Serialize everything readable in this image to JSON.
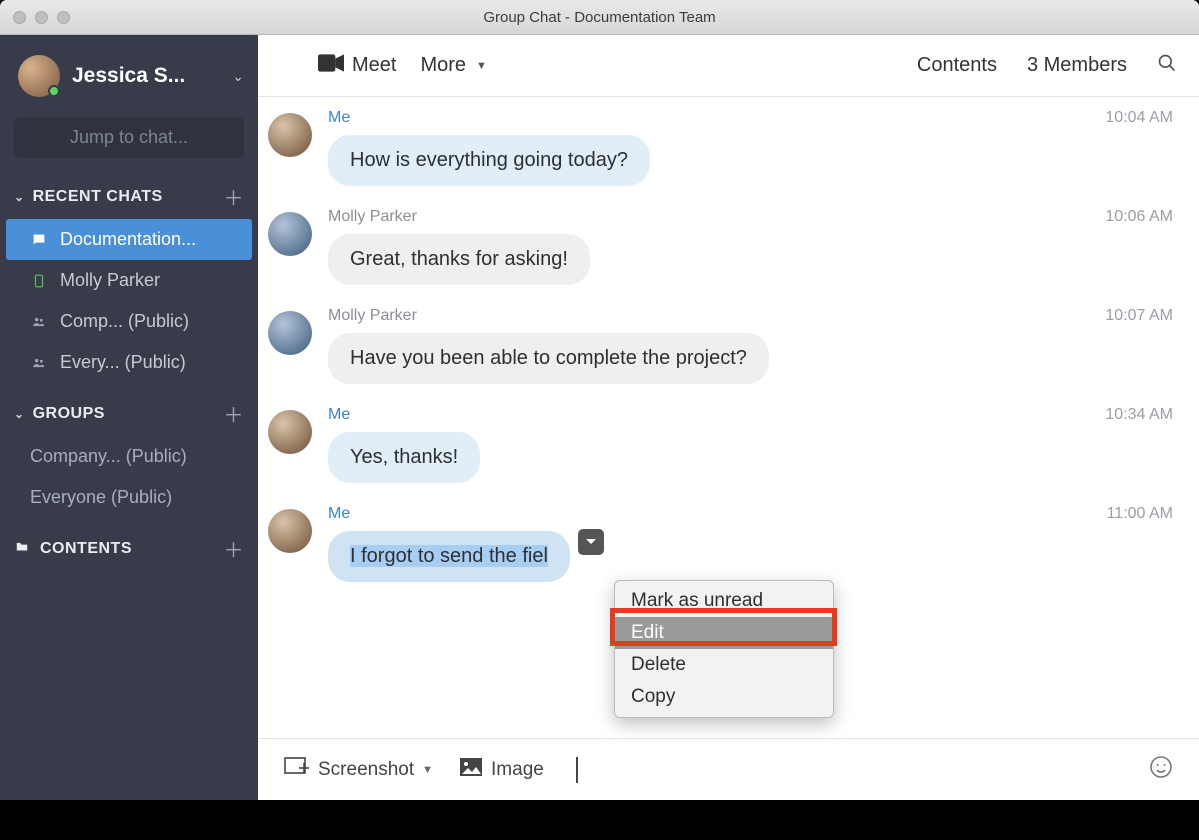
{
  "window": {
    "title": "Group Chat - Documentation Team"
  },
  "sidebar": {
    "profile_name": "Jessica S...",
    "jump_placeholder": "Jump to chat...",
    "sections": {
      "recent": {
        "label": "RECENT CHATS"
      },
      "groups": {
        "label": "GROUPS"
      },
      "contents": {
        "label": "CONTENTS"
      }
    },
    "recent_items": [
      {
        "label": "Documentation..."
      },
      {
        "label": "Molly Parker"
      },
      {
        "label": "Comp... (Public)"
      },
      {
        "label": "Every... (Public)"
      }
    ],
    "group_items": [
      {
        "label": "Company... (Public)"
      },
      {
        "label": "Everyone (Public)"
      }
    ]
  },
  "topbar": {
    "meet": "Meet",
    "more": "More",
    "contents": "Contents",
    "members": "3 Members"
  },
  "messages": [
    {
      "sender": "Me",
      "me": true,
      "time": "10:04 AM",
      "text": "How is everything going today?"
    },
    {
      "sender": "Molly Parker",
      "me": false,
      "time": "10:06 AM",
      "text": "Great, thanks for asking!"
    },
    {
      "sender": "Molly Parker",
      "me": false,
      "time": "10:07 AM",
      "text": "Have you been able to complete the project?"
    },
    {
      "sender": "Me",
      "me": true,
      "time": "10:34 AM",
      "text": "Yes, thanks!"
    },
    {
      "sender": "Me",
      "me": true,
      "time": "11:00 AM",
      "text": "I forgot to send the fiel",
      "selected": true,
      "menu_open": true
    }
  ],
  "context_menu": {
    "items": [
      "Mark as unread",
      "Edit",
      "Delete",
      "Copy"
    ],
    "highlighted_index": 1
  },
  "composer": {
    "screenshot": "Screenshot",
    "image": "Image"
  }
}
